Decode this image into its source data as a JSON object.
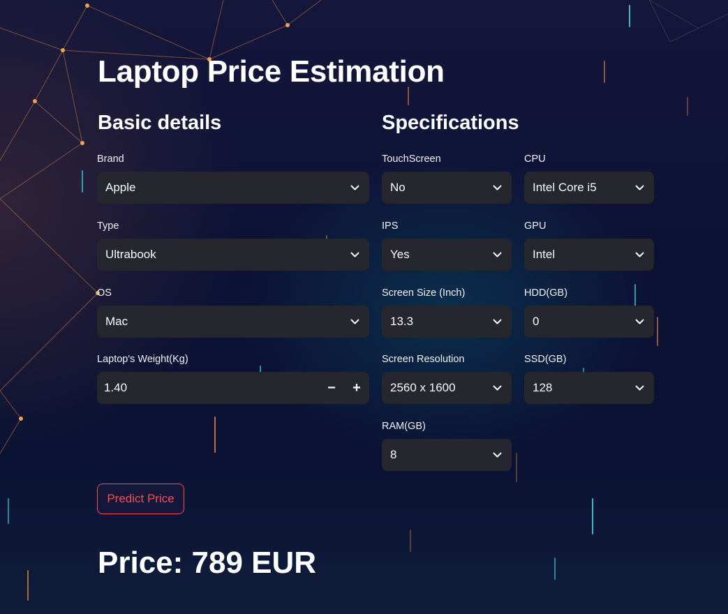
{
  "app": {
    "title": "Laptop Price Estimation"
  },
  "basic": {
    "heading": "Basic details",
    "brand": {
      "label": "Brand",
      "value": "Apple"
    },
    "type": {
      "label": "Type",
      "value": "Ultrabook"
    },
    "os": {
      "label": "OS",
      "value": "Mac"
    },
    "weight": {
      "label": "Laptop's Weight(Kg)",
      "value": "1.40",
      "minus": "−",
      "plus": "+"
    }
  },
  "specs": {
    "heading": "Specifications",
    "touchscreen": {
      "label": "TouchScreen",
      "value": "No"
    },
    "cpu": {
      "label": "CPU",
      "value": "Intel Core i5"
    },
    "ips": {
      "label": "IPS",
      "value": "Yes"
    },
    "gpu": {
      "label": "GPU",
      "value": "Intel"
    },
    "screen_size": {
      "label": "Screen Size (Inch)",
      "value": "13.3"
    },
    "hdd": {
      "label": "HDD(GB)",
      "value": "0"
    },
    "screen_resolution": {
      "label": "Screen Resolution",
      "value": "2560 x 1600"
    },
    "ssd": {
      "label": "SSD(GB)",
      "value": "128"
    },
    "ram": {
      "label": "RAM(GB)",
      "value": "8"
    }
  },
  "actions": {
    "predict_label": "Predict Price"
  },
  "result": {
    "price_text": "Price: 789 EUR"
  },
  "colors": {
    "accent": "#ff4b4b",
    "input_bg": "#26272e",
    "page_bg": "#0d1235"
  },
  "icons": {
    "dropdown": "chevron-down-icon"
  }
}
